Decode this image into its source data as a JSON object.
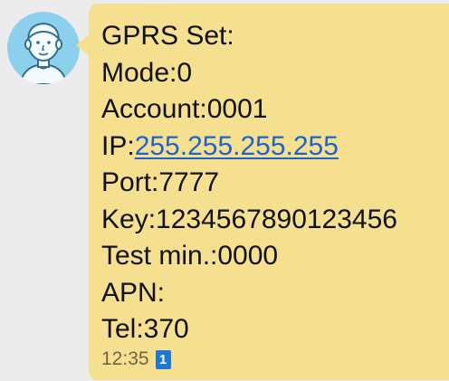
{
  "message": {
    "lines": [
      "GPRS Set:",
      "Mode:0",
      "Account:0001"
    ],
    "ip_label": "IP:",
    "ip_value": "255.255.255.255",
    "lines_after": [
      "Port:7777",
      "Key:1234567890123456",
      "Test min.:0000",
      "APN:",
      "Tel:370"
    ],
    "time": "12:35",
    "sim_badge": "1"
  },
  "colors": {
    "bubble": "#f5e08f",
    "background": "#ececec",
    "link": "#1b64d0",
    "avatar": "#8cd0ee",
    "sim_badge": "#1a78d8"
  },
  "icons": {
    "avatar": "default-user-avatar-icon",
    "sim": "sim-1-badge-icon"
  }
}
